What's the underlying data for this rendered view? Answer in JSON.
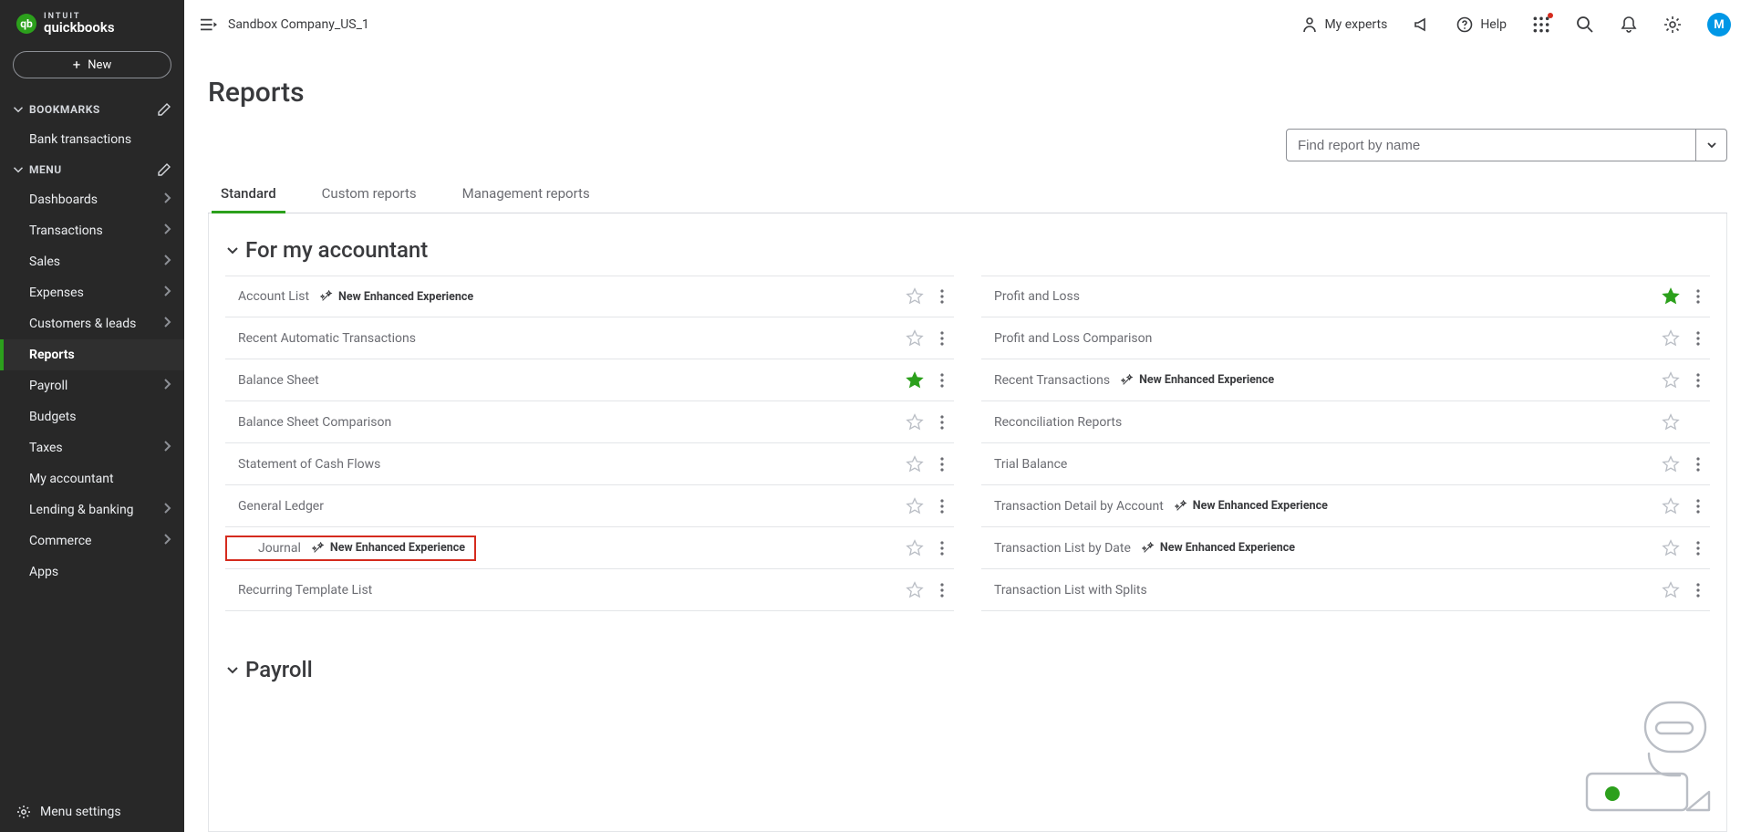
{
  "brand": {
    "intuit": "INTUIT",
    "qb": "quickbooks",
    "mark": "qb"
  },
  "new_button": "New",
  "sidebar": {
    "sections": {
      "bookmarks": {
        "label": "BOOKMARKS"
      },
      "menu": {
        "label": "MENU"
      }
    },
    "bookmarks": [
      {
        "label": "Bank transactions"
      }
    ],
    "menu": [
      {
        "label": "Dashboards",
        "chevron": true
      },
      {
        "label": "Transactions",
        "chevron": true
      },
      {
        "label": "Sales",
        "chevron": true
      },
      {
        "label": "Expenses",
        "chevron": true
      },
      {
        "label": "Customers & leads",
        "chevron": true
      },
      {
        "label": "Reports",
        "chevron": false,
        "active": true
      },
      {
        "label": "Payroll",
        "chevron": true
      },
      {
        "label": "Budgets",
        "chevron": false
      },
      {
        "label": "Taxes",
        "chevron": true
      },
      {
        "label": "My accountant",
        "chevron": false
      },
      {
        "label": "Lending & banking",
        "chevron": true
      },
      {
        "label": "Commerce",
        "chevron": true
      },
      {
        "label": "Apps",
        "chevron": false
      }
    ],
    "footer": "Menu settings"
  },
  "topbar": {
    "company": "Sandbox Company_US_1",
    "my_experts": "My experts",
    "help": "Help",
    "avatar": "M"
  },
  "page": {
    "title": "Reports",
    "search_placeholder": "Find report by name"
  },
  "tabs": [
    {
      "label": "Standard",
      "active": true
    },
    {
      "label": "Custom reports"
    },
    {
      "label": "Management reports"
    }
  ],
  "enhanced_badge": "New Enhanced Experience",
  "groups": [
    {
      "title": "For my accountant",
      "left": [
        {
          "name": "Account List",
          "enhanced": true,
          "fav": false,
          "more": true
        },
        {
          "name": "Recent Automatic Transactions",
          "fav": false,
          "more": true
        },
        {
          "name": "Balance Sheet",
          "fav": true,
          "more": true
        },
        {
          "name": "Balance Sheet Comparison",
          "fav": false,
          "more": true
        },
        {
          "name": "Statement of Cash Flows",
          "fav": false,
          "more": true
        },
        {
          "name": "General Ledger",
          "fav": false,
          "more": true
        },
        {
          "name": "Journal",
          "enhanced": true,
          "fav": false,
          "more": true,
          "highlight": true
        },
        {
          "name": "Recurring Template List",
          "fav": false,
          "more": true
        }
      ],
      "right": [
        {
          "name": "Profit and Loss",
          "fav": true,
          "more": true
        },
        {
          "name": "Profit and Loss Comparison",
          "fav": false,
          "more": true
        },
        {
          "name": "Recent Transactions",
          "enhanced": true,
          "fav": false,
          "more": true
        },
        {
          "name": "Reconciliation Reports",
          "fav": false,
          "more": false
        },
        {
          "name": "Trial Balance",
          "fav": false,
          "more": true
        },
        {
          "name": "Transaction Detail by Account",
          "enhanced": true,
          "fav": false,
          "more": true
        },
        {
          "name": "Transaction List by Date",
          "enhanced": true,
          "fav": false,
          "more": true
        },
        {
          "name": "Transaction List with Splits",
          "fav": false,
          "more": true
        }
      ]
    },
    {
      "title": "Payroll",
      "left": [],
      "right": []
    }
  ]
}
